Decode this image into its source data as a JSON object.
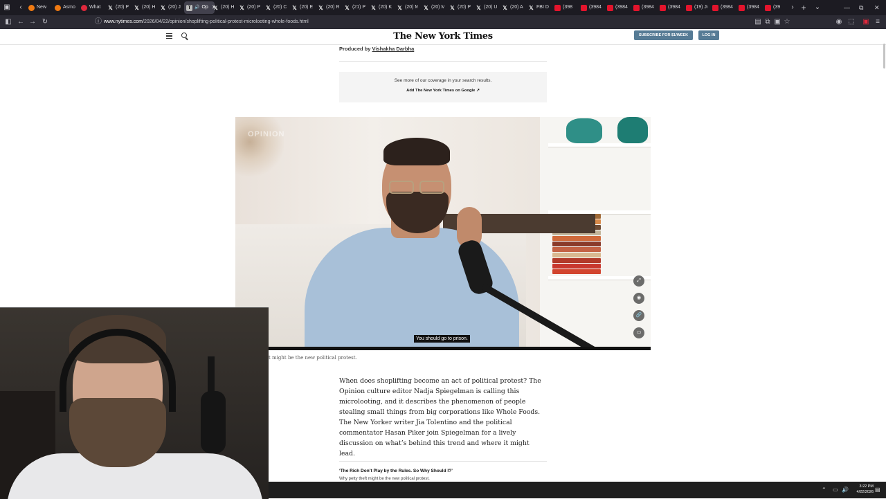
{
  "browser": {
    "tabs": [
      {
        "label": "New",
        "icon": "firefox-icon"
      },
      {
        "label": "Asmo",
        "icon": "twitch-icon"
      },
      {
        "label": "What",
        "icon": "reddit-icon"
      },
      {
        "label": "(20) P",
        "icon": "x-icon"
      },
      {
        "label": "(20) H",
        "icon": "x-icon"
      },
      {
        "label": "(20) J",
        "icon": "x-icon"
      },
      {
        "label": "Op",
        "icon": "nyt-icon",
        "active": true
      },
      {
        "label": "(20) H",
        "icon": "x-icon"
      },
      {
        "label": "(20) P",
        "icon": "x-icon"
      },
      {
        "label": "(20) C",
        "icon": "x-icon"
      },
      {
        "label": "(20) E",
        "icon": "x-icon"
      },
      {
        "label": "(20) R",
        "icon": "x-icon"
      },
      {
        "label": "(21) P",
        "icon": "x-icon"
      },
      {
        "label": "(20) K",
        "icon": "x-icon"
      },
      {
        "label": "(20) M",
        "icon": "x-icon"
      },
      {
        "label": "(20) M",
        "icon": "x-icon"
      },
      {
        "label": "(20) P",
        "icon": "x-icon"
      },
      {
        "label": "(20) U",
        "icon": "x-icon"
      },
      {
        "label": "(20) A",
        "icon": "x-icon"
      },
      {
        "label": "FBI D",
        "icon": "x-icon"
      },
      {
        "label": "(398",
        "icon": "youtube-icon"
      },
      {
        "label": "(3984",
        "icon": "youtube-icon"
      },
      {
        "label": "(3984",
        "icon": "youtube-icon"
      },
      {
        "label": "(3984",
        "icon": "youtube-icon"
      },
      {
        "label": "(3984",
        "icon": "youtube-icon"
      },
      {
        "label": "(19) Ju",
        "icon": "youtube-icon"
      },
      {
        "label": "(3984",
        "icon": "youtube-icon"
      },
      {
        "label": "(3984",
        "icon": "youtube-icon"
      },
      {
        "label": "(39",
        "icon": "youtube-icon"
      }
    ],
    "url_host": "www.nytimes.com",
    "url_path": "/2026/04/22/opinion/shoplifting-political-protest-microlooting-whole-foods.html"
  },
  "site": {
    "logo": "The New York Times",
    "subscribe_label": "SUBSCRIBE FOR $1/WEEK",
    "login_label": "LOG IN"
  },
  "article": {
    "produced_prefix": "Produced by",
    "produced_name": "Vishakha Darbha",
    "coverage_text": "See more of our coverage in your search results.",
    "coverage_link": "Add The New York Times on Google ↗",
    "video_watermark": "OPINION",
    "video_subtitle": "You should go to prison.",
    "caption": "t might be the new political protest.",
    "body": "When does shoplifting become an act of political protest? The Opinion culture editor Nadja Spiegelman is calling this microlooting, and it describes the phenomenon of people stealing small things from big corporations like Whole Foods. The New Yorker writer Jia Tolentino and the political commentator Hasan Piker join Spiegelman for a lively discussion on what’s behind this trend and where it might lead.",
    "related_title": "‘The Rich Don’t Play by the Rules. So Why Should I?’",
    "related_sub": "Why petty theft might be the new political protest."
  },
  "taskbar": {
    "time": "3:22 PM",
    "date": "4/22/2026"
  }
}
